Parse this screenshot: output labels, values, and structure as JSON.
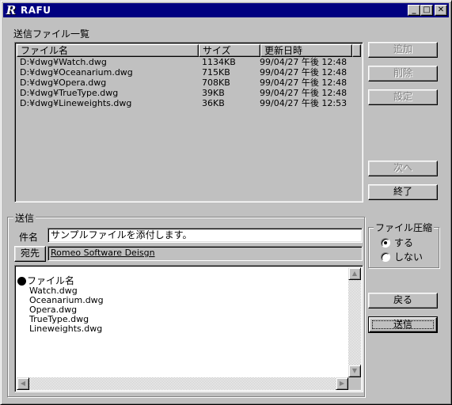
{
  "window": {
    "title": "RAFU",
    "icon": "R"
  },
  "titlebar_buttons": {
    "minimize": "_",
    "maximize": "□",
    "close": "✕"
  },
  "file_list": {
    "label": "送信ファイル一覧",
    "columns": [
      "ファイル名",
      "サイズ",
      "更新日時"
    ],
    "rows": [
      [
        "D:¥dwg¥Watch.dwg",
        "1134KB",
        "99/04/27 午後 12:48"
      ],
      [
        "D:¥dwg¥Oceanarium.dwg",
        "715KB",
        "99/04/27 午後 12:48"
      ],
      [
        "D:¥dwg¥Opera.dwg",
        "708KB",
        "99/04/27 午後 12:48"
      ],
      [
        "D:¥dwg¥TrueType.dwg",
        "39KB",
        "99/04/27 午後 12:48"
      ],
      [
        "D:¥dwg¥Lineweights.dwg",
        "36KB",
        "99/04/27 午後 12:53"
      ]
    ]
  },
  "buttons": {
    "add": "追加",
    "delete": "削除",
    "settings": "設定",
    "next": "次へ",
    "exit": "終了",
    "back": "戻る",
    "send": "送信"
  },
  "send_group": {
    "label": "送信",
    "subject_label": "件名",
    "subject_value": "サンプルファイルを添付します。",
    "recipient_button": "宛先",
    "recipient_value": "Romeo Software Deisgn"
  },
  "compression": {
    "label": "ファイル圧縮",
    "options": [
      "する",
      "しない"
    ],
    "selected": "する"
  },
  "body": {
    "heading": "ファイル名",
    "files": [
      "Watch.dwg",
      "Oceanarium.dwg",
      "Opera.dwg",
      "TrueType.dwg",
      "Lineweights.dwg"
    ]
  },
  "colors": {
    "titlebar": "#000080",
    "face": "#c0c0c0"
  }
}
